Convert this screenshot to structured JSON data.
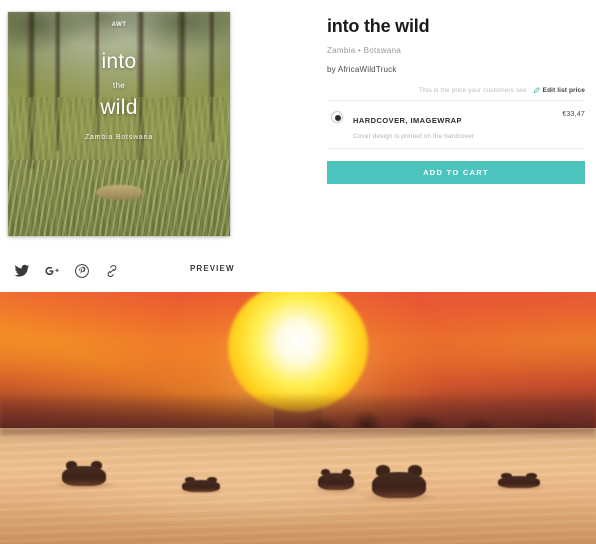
{
  "product": {
    "title": "into the wild",
    "subtitle": "Zambia • Botswana",
    "byline": "by AfricaWildTruck",
    "price_note": "This is the price your customers see",
    "edit_link_label": "Edit list price",
    "option": {
      "name": "HARDCOVER, IMAGEWRAP",
      "description": "Cover design is printed on the hardcover",
      "price": "€33,47",
      "selected": true
    },
    "cart_button_label": "ADD TO CART"
  },
  "cover": {
    "logo": "AWT",
    "line1": "into",
    "line2": "the",
    "line3": "wild",
    "subtitle": "Zambia Botswana"
  },
  "share_bar": {
    "preview_label": "PREVIEW",
    "icons": [
      {
        "name": "twitter-icon",
        "label": "Twitter"
      },
      {
        "name": "google-plus-icon",
        "label": "Google Plus"
      },
      {
        "name": "pinterest-icon",
        "label": "Pinterest"
      },
      {
        "name": "link-icon",
        "label": "Copy link"
      }
    ]
  },
  "hero_photo": {
    "caption": "Sunset over water with five hippos surfacing",
    "hippo_count": 5
  },
  "colors": {
    "accent_teal": "#4cc3bd",
    "title_text": "#1b1b1b",
    "muted_text": "#b4b4b4",
    "divider": "#ececec",
    "sun_yellow": "#ffef52",
    "sky_orange": "#ef6238",
    "water_sand": "#efc290"
  }
}
